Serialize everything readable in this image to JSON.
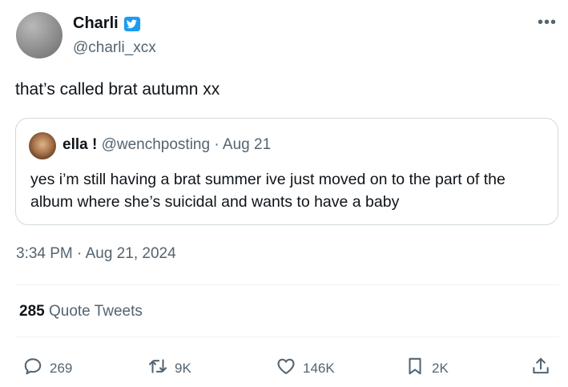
{
  "author": {
    "display_name": "Charli",
    "handle": "@charli_xcx",
    "verified_badge": "verified-badge-icon"
  },
  "more_menu": "•••",
  "tweet": {
    "text": "that’s called brat autumn xx"
  },
  "quoted_tweet": {
    "display_name": "ella !",
    "handle": "@wenchposting",
    "separator": "·",
    "date": "Aug 21",
    "text": "yes i’m still having a brat summer ive just moved on to the part of the album where she’s suicidal and wants to have a baby"
  },
  "timestamp": "3:34 PM · Aug 21, 2024",
  "quote_tweets": {
    "count": "285",
    "label": "Quote Tweets"
  },
  "actions": {
    "replies": "269",
    "retweets": "9K",
    "likes": "146K",
    "bookmarks": "2K"
  },
  "colors": {
    "text": "#0f1419",
    "secondary": "#536471",
    "verified": "#1d9bf0",
    "border": "#cfd9de"
  }
}
